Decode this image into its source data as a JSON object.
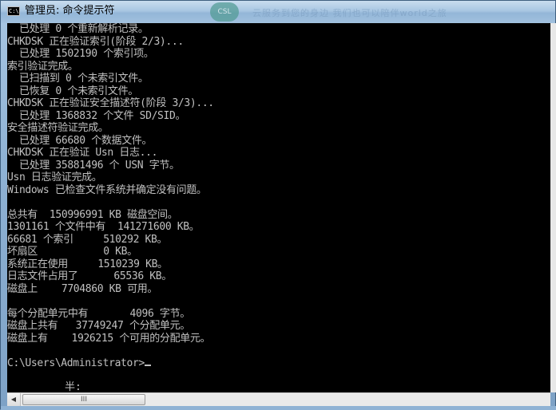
{
  "window": {
    "title": "管理员: 命令提示符",
    "title_icon_glyph": "C:\\",
    "title_icon": "cmd-icon",
    "blurred_badge": "CSL",
    "blurred_text": "云服务到您的身边 我们也可以陪伴world之旅"
  },
  "console": {
    "lines": [
      "  已处理 0 个重新解析记录。",
      "CHKDSK 正在验证索引(阶段 2/3)...",
      "  已处理 1502190 个索引项。",
      "索引验证完成。",
      "  已扫描到 0 个未索引文件。",
      "  已恢复 0 个未索引文件。",
      "CHKDSK 正在验证安全描述符(阶段 3/3)...",
      "  已处理 1368832 个文件 SD/SID。",
      "安全描述符验证完成。",
      "  已处理 66680 个数据文件。",
      "CHKDSK 正在验证 Usn 日志...",
      "  已处理 35881496 个 USN 字节。",
      "Usn 日志验证完成。",
      "Windows 已检查文件系统并确定没有问题。",
      "",
      "总共有  150996991 KB 磁盘空间。",
      "1301161 个文件中有  141271600 KB。",
      "66681 个索引     510292 KB。",
      "坏扇区           0 KB。",
      "系统正在使用     1510239 KB。",
      "日志文件占用了      65536 KB。",
      "磁盘上    7704860 KB 可用。",
      "",
      "每个分配单元中有       4096 字节。",
      "磁盘上共有   37749247 个分配单元。",
      "磁盘上有    1926215 个可用的分配单元。",
      "",
      "C:\\Users\\Administrator>"
    ],
    "ime_text": "半:"
  },
  "scrollbar": {
    "thumb_grip": "III",
    "left_arrow": "◀"
  }
}
